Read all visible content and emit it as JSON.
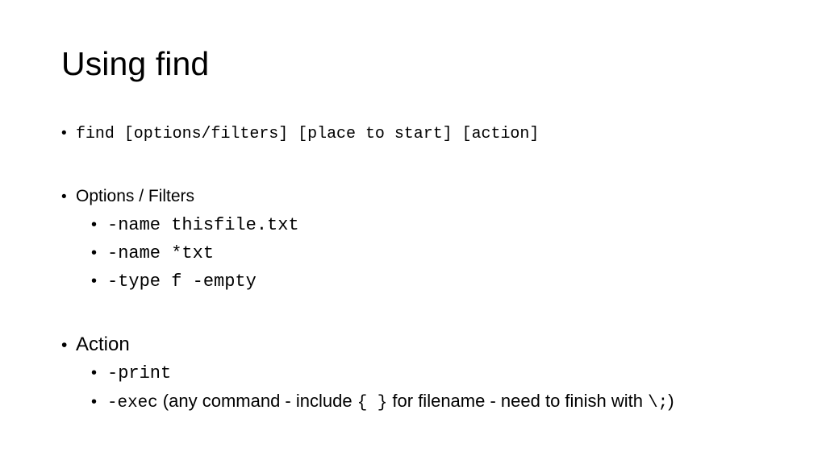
{
  "slide": {
    "title": "Using find",
    "bullet_glyph": "•",
    "text_color": "#000000",
    "background_color": "#ffffff"
  },
  "content": {
    "syntax_line": {
      "command": "find ",
      "options_token": "[options/filters] ",
      "place_token": "[place to start] ",
      "action_token": "[action]"
    },
    "options_section": {
      "heading": "Options / Filters",
      "items": [
        {
          "code": "-name thisfile.txt"
        },
        {
          "code": "-name *txt"
        },
        {
          "code": "-type f -empty"
        }
      ]
    },
    "action_section": {
      "heading": "Action",
      "items": [
        {
          "code": "-print",
          "note_before": "",
          "braces": "",
          "note_after": "",
          "escape": "",
          "tail": ""
        },
        {
          "code": "-exec",
          "note_before": " (any command - include ",
          "braces": "{ }",
          "note_after": " for filename - need to finish with ",
          "escape": "\\;",
          "tail": ")"
        }
      ]
    }
  }
}
